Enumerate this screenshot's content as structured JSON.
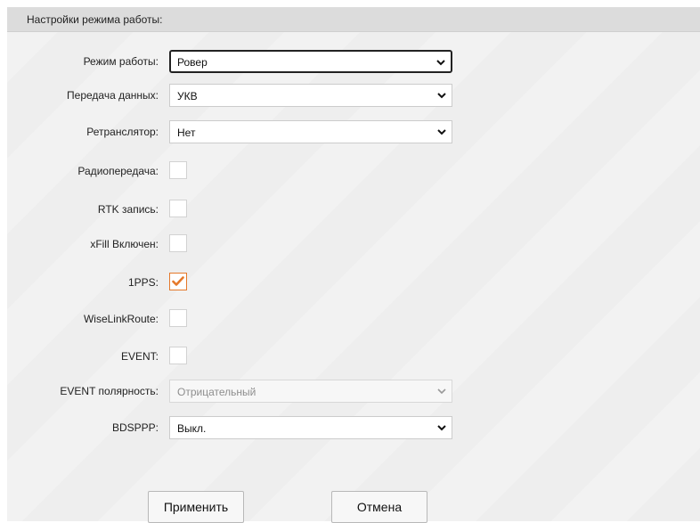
{
  "panel": {
    "title": "Настройки режима работы:"
  },
  "fields": {
    "work_mode": {
      "label": "Режим работы:",
      "value": "Ровер"
    },
    "data_transfer": {
      "label": "Передача данных:",
      "value": "УКВ"
    },
    "repeater": {
      "label": "Ретранслятор:",
      "value": "Нет"
    },
    "radio_transmit": {
      "label": "Радиопередача:",
      "checked": false
    },
    "rtk_record": {
      "label": "RTK запись:",
      "checked": false
    },
    "xfill": {
      "label": "xFill Включен:",
      "checked": false
    },
    "pps": {
      "label": "1PPS:",
      "checked": true
    },
    "wiselink": {
      "label": "WiseLinkRoute:",
      "checked": false
    },
    "event": {
      "label": "EVENT:",
      "checked": false
    },
    "event_polarity": {
      "label": "EVENT полярность:",
      "value": "Отрицательный",
      "disabled": true
    },
    "bdsppp": {
      "label": "BDSPPP:",
      "value": "Выкл."
    }
  },
  "buttons": {
    "apply": "Применить",
    "cancel": "Отмена"
  },
  "colors": {
    "accent": "#e5792b",
    "header_bg": "#dcdcdc",
    "panel_bg": "#f2f2f2"
  }
}
